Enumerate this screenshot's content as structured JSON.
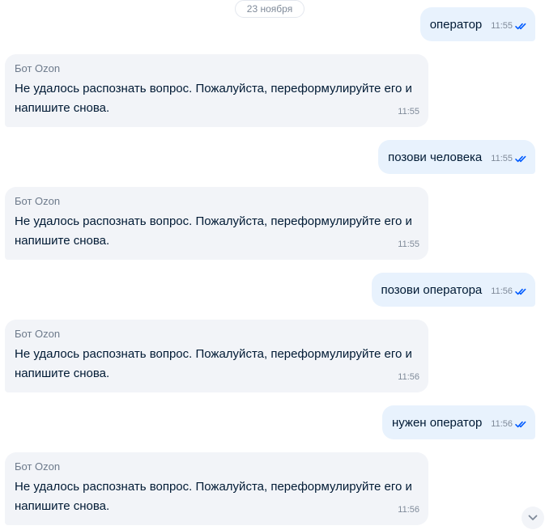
{
  "date_separator": "23 ноября",
  "messages": [
    {
      "text": "оператор",
      "time": "11:55"
    },
    {
      "sender": "Бот Ozon",
      "text": "Не удалось распознать вопрос. Пожалуйста, переформулируйте его и напишите снова.",
      "time": "11:55"
    },
    {
      "text": "позови человека",
      "time": "11:55"
    },
    {
      "sender": "Бот Ozon",
      "text": "Не удалось распознать вопрос. Пожалуйста, переформулируйте его и напишите снова.",
      "time": "11:55"
    },
    {
      "text": "позови оператора",
      "time": "11:56"
    },
    {
      "sender": "Бот Ozon",
      "text": "Не удалось распознать вопрос. Пожалуйста, переформулируйте его и напишите снова.",
      "time": "11:56"
    },
    {
      "text": "нужен оператор",
      "time": "11:56"
    },
    {
      "sender": "Бот Ozon",
      "text": "Не удалось распознать вопрос. Пожалуйста, переформулируйте его и напишите снова.",
      "time": "11:56"
    }
  ],
  "colors": {
    "outgoing_bubble": "#e8f2fd",
    "incoming_bubble": "#f2f4f8",
    "read_check": "#005bff",
    "text": "#001a34",
    "muted": "#7f8a99"
  },
  "icons": {
    "read_status": "double-check-icon",
    "scroll_down": "chevron-down-icon"
  }
}
